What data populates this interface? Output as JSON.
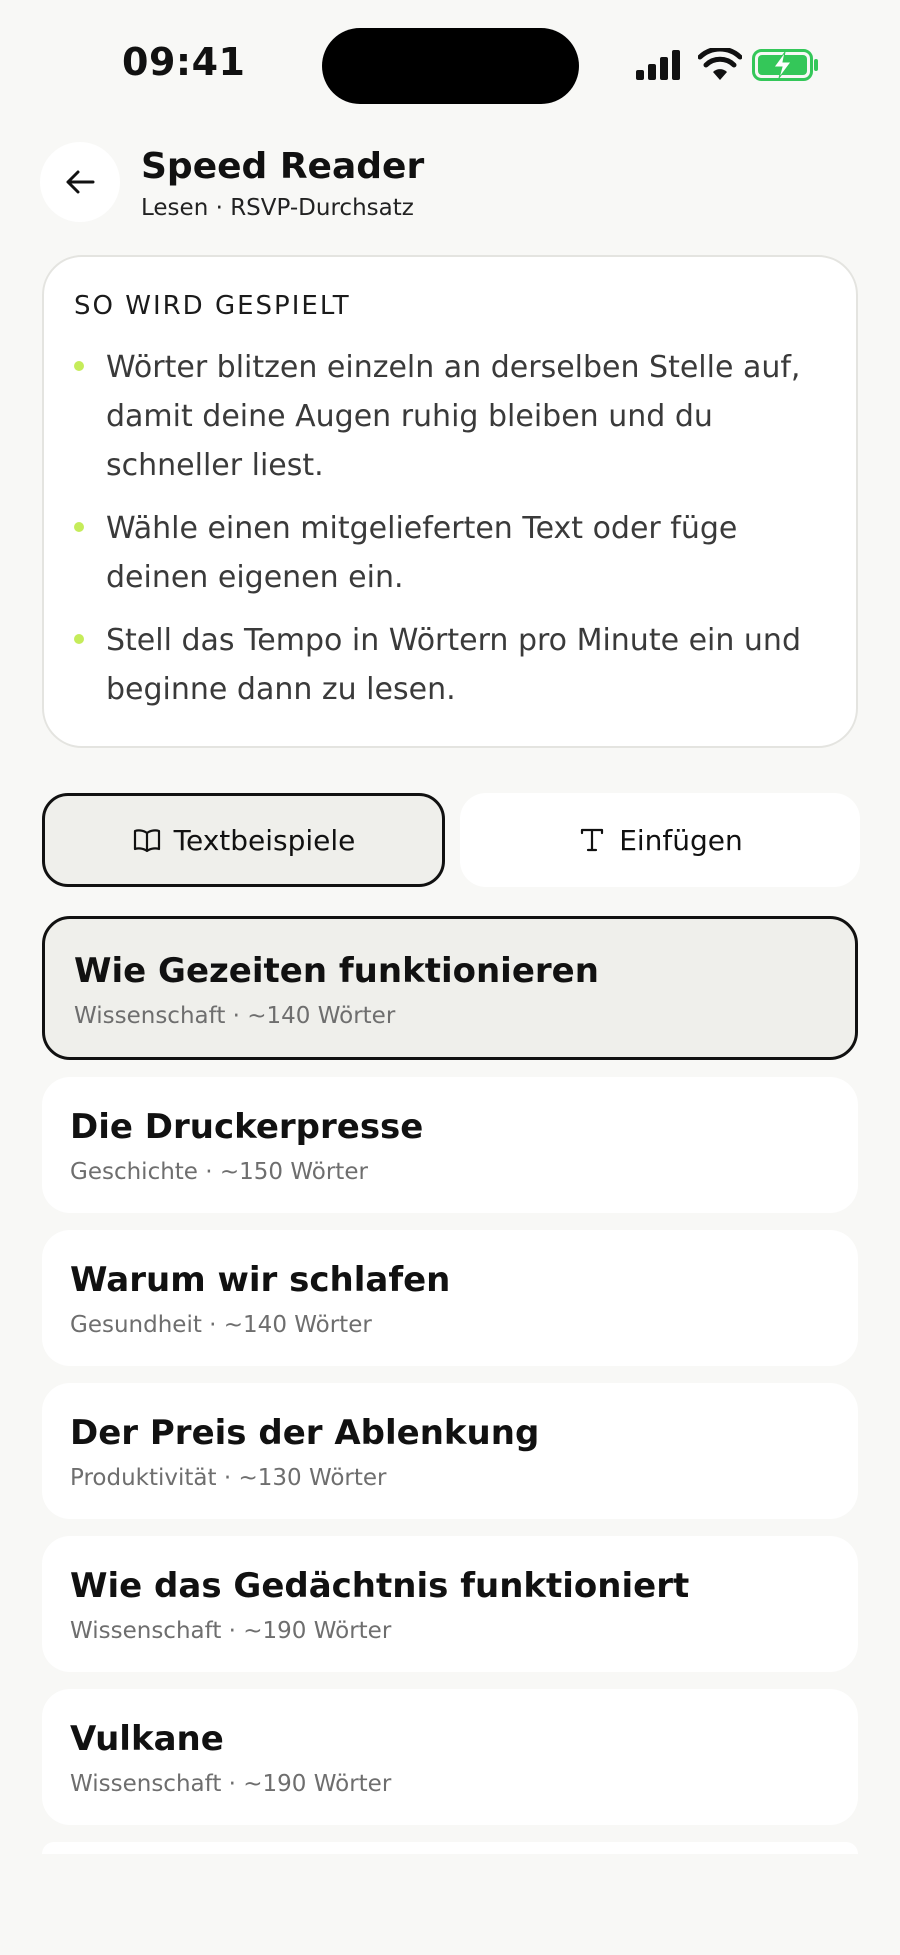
{
  "status_bar": {
    "time": "09:41",
    "icons": [
      "signal-icon",
      "wifi-icon",
      "battery-charging-icon"
    ],
    "battery_color": "#34c759"
  },
  "header": {
    "back_icon": "arrow-left-icon",
    "title": "Speed Reader",
    "subtitle": "Lesen · RSVP-Durchsatz"
  },
  "howto": {
    "heading": "SO WIRD GESPIELT",
    "bullet_color": "#c5ec5a",
    "items": [
      "Wörter blitzen einzeln an derselben Stelle auf, damit deine Augen ruhig bleiben und du schneller liest.",
      "Wähle einen mitgelieferten Text oder füge deinen eigenen ein.",
      "Stell das Tempo in Wörtern pro Minute ein und beginne dann zu lesen."
    ]
  },
  "tabs": [
    {
      "label": "Textbeispiele",
      "icon": "book-icon",
      "active": true
    },
    {
      "label": "Einfügen",
      "icon": "text-icon",
      "active": false
    }
  ],
  "texts": [
    {
      "title": "Wie Gezeiten funktionieren",
      "meta": "Wissenschaft · ~140 Wörter",
      "selected": true
    },
    {
      "title": "Die Druckerpresse",
      "meta": "Geschichte · ~150 Wörter",
      "selected": false
    },
    {
      "title": "Warum wir schlafen",
      "meta": "Gesundheit · ~140 Wörter",
      "selected": false
    },
    {
      "title": "Der Preis der Ablenkung",
      "meta": "Produktivität · ~130 Wörter",
      "selected": false
    },
    {
      "title": "Wie das Gedächtnis funktioniert",
      "meta": "Wissenschaft · ~190 Wörter",
      "selected": false
    },
    {
      "title": "Vulkane",
      "meta": "Wissenschaft · ~190 Wörter",
      "selected": false
    }
  ]
}
